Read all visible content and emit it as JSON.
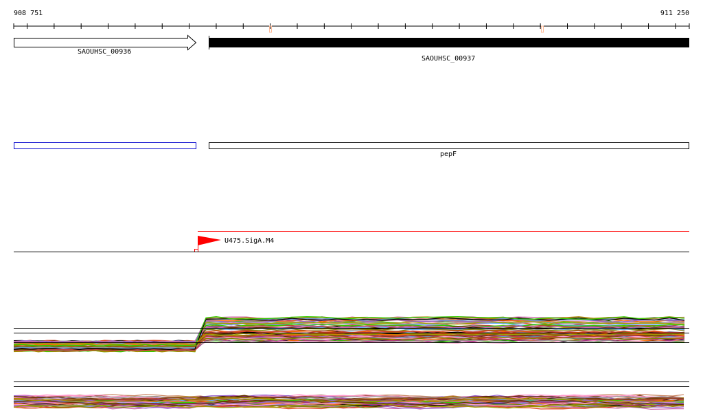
{
  "ruler": {
    "start_label": "908 751",
    "end_label": "911 250"
  },
  "genes": [
    {
      "name": "SAOUHSC_00936",
      "strand": "+",
      "style": "open-arrow"
    },
    {
      "name": "SAOUHSC_00937",
      "strand": "-",
      "style": "filled"
    }
  ],
  "operons": [
    {
      "name": ""
    },
    {
      "name": "pepF"
    }
  ],
  "promoter": {
    "name": "U475.SigA.M4",
    "color": "#ff0000"
  },
  "profile_colors": [
    "#000000",
    "#808000",
    "#ff6a00",
    "#c04040",
    "#a0a000",
    "#33cc00",
    "#aa3388",
    "#66aaff",
    "#cc8866",
    "#884422",
    "#ff99cc",
    "#9966cc",
    "#663300",
    "#aa8800",
    "#dd4422",
    "#999999",
    "#6699cc",
    "#cc66aa"
  ]
}
